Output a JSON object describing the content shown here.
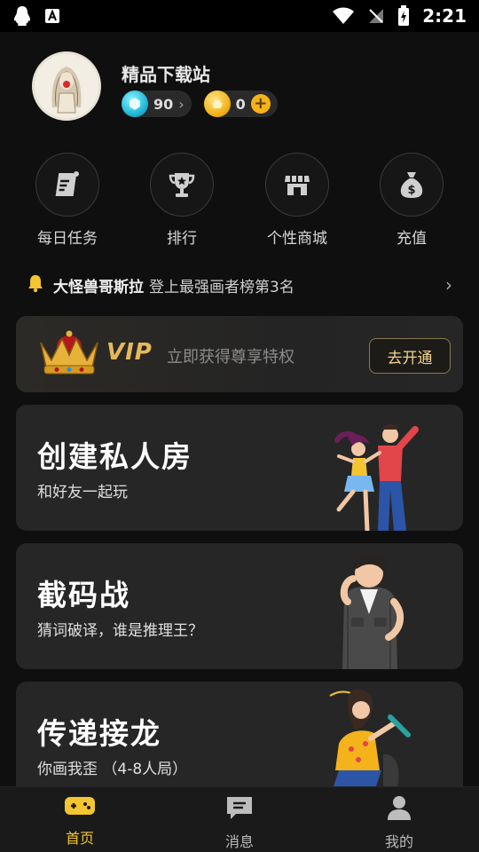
{
  "status_bar": {
    "time": "2:21",
    "icons": [
      "qq-icon",
      "font-icon",
      "wifi-icon",
      "no-signal-icon",
      "battery-charging-icon"
    ]
  },
  "profile": {
    "username": "精品下载站",
    "gems": "90",
    "coins": "0"
  },
  "quick_actions": [
    {
      "label": "每日任务",
      "icon": "task-icon"
    },
    {
      "label": "排行",
      "icon": "trophy-icon"
    },
    {
      "label": "个性商城",
      "icon": "store-icon"
    },
    {
      "label": "充值",
      "icon": "money-bag-icon"
    }
  ],
  "announcement": {
    "name": "大怪兽哥斯拉",
    "text": "登上最强画者榜第3名"
  },
  "vip": {
    "badge": "VIP",
    "text": "立即获得尊享特权",
    "button": "去开通"
  },
  "games": [
    {
      "title": "创建私人房",
      "subtitle": "和好友一起玩"
    },
    {
      "title": "截码战",
      "subtitle": "猜词破译，谁是推理王？"
    },
    {
      "title": "传递接龙",
      "subtitle": "你画我歪 （4-8人局）"
    }
  ],
  "bottom_nav": [
    {
      "label": "首页",
      "icon": "gamepad-icon",
      "active": true
    },
    {
      "label": "消息",
      "icon": "message-icon",
      "active": false
    },
    {
      "label": "我的",
      "icon": "user-icon",
      "active": false
    }
  ],
  "colors": {
    "background": "#0f0f0f",
    "card": "#262626",
    "accent": "#f4c431",
    "vip_gold": "#e6b85a"
  }
}
